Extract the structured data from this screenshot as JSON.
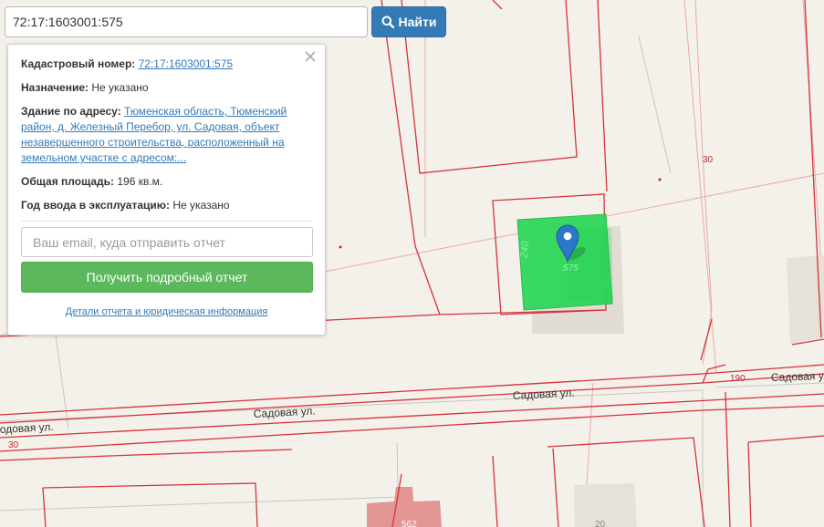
{
  "search": {
    "value": "72:17:1603001:575",
    "button_label": "Найти"
  },
  "popup": {
    "cadastral_label": "Кадастровый номер:",
    "cadastral_value": "72:17:1603001:575",
    "purpose_label": "Назначение:",
    "purpose_value": "Не указано",
    "address_label": "Здание по адресу:",
    "address_line1": "Тюменская область, Тюменский",
    "address_line2": "район, д. Железный Перебор, ул. Садовая, объект",
    "address_line3": "незавершенного строительства, расположенный на",
    "address_line4": "земельном участке с адресом:...",
    "area_label": "Общая площадь:",
    "area_value": "196 кв.м.",
    "year_label": "Год ввода в эксплуатацию:",
    "year_value": "Не указано",
    "email_placeholder": "Ваш email, куда отправить отчет",
    "report_button": "Получить подробный отчет",
    "details_link": "Детали отчета и юридическая информация"
  },
  "map": {
    "street_labels": [
      "Садовая ул.",
      "Садовая ул.",
      "Садовая ул",
      "одовая ул."
    ],
    "numbers": [
      "30",
      "30",
      "190",
      "240",
      "575",
      "562",
      "20"
    ],
    "colors": {
      "background": "#f4f1ea",
      "parcel_lines": "#d6323a",
      "highlight": "#2fd85a",
      "building": "#e2ddd4",
      "building_red": "#e39593",
      "marker": "#2a79c9"
    }
  }
}
